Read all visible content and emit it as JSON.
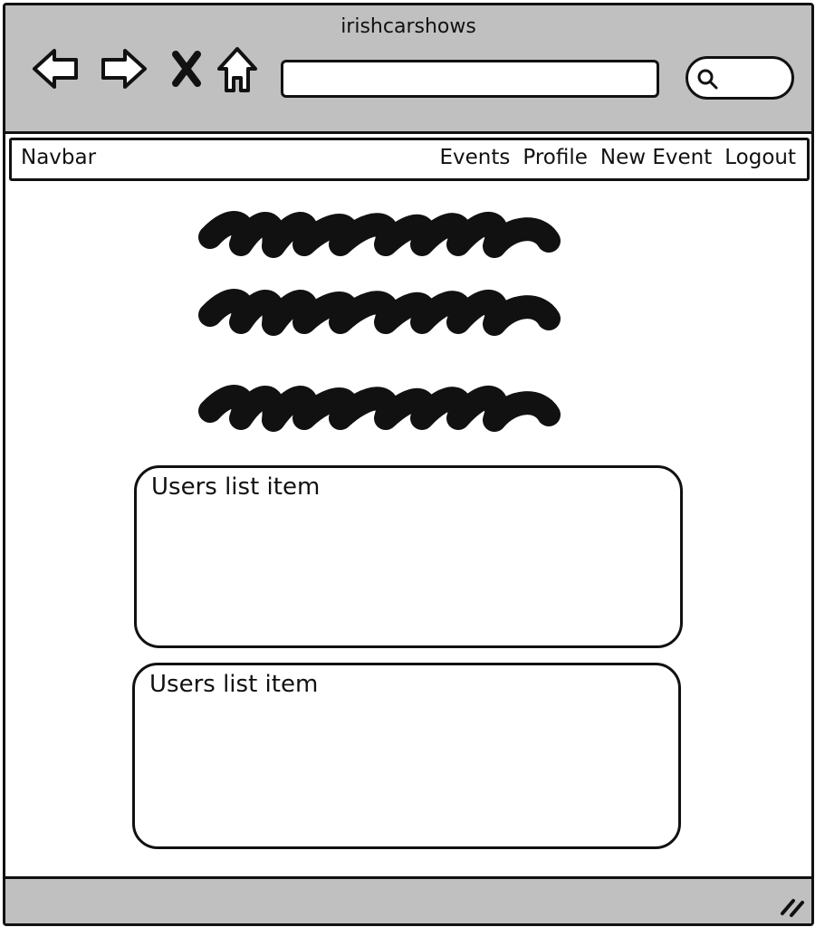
{
  "window": {
    "title": "irishcarshows"
  },
  "toolbar": {
    "icons": [
      "back-arrow-icon",
      "forward-arrow-icon",
      "stop-icon",
      "home-icon"
    ],
    "address_value": "",
    "search_value": ""
  },
  "navbar": {
    "brand": "Navbar",
    "links": [
      "Events",
      "Profile",
      "New Event",
      "Logout"
    ]
  },
  "main": {
    "users_list": [
      {
        "label": "Users list item"
      },
      {
        "label": "Users list item"
      }
    ]
  },
  "colors": {
    "chrome": "#c0c0c0",
    "ink": "#111111",
    "background": "#ffffff"
  }
}
